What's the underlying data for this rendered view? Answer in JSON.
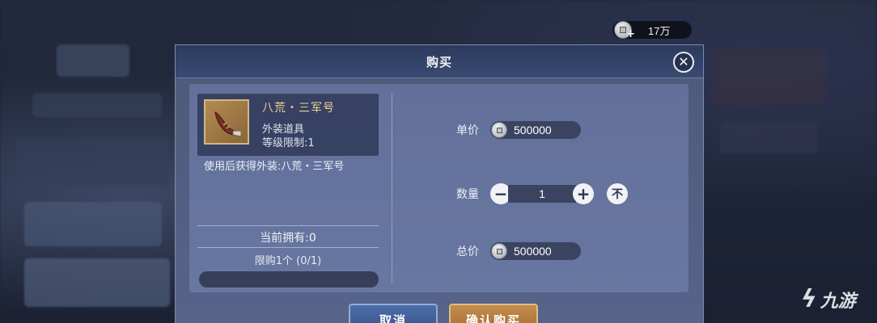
{
  "currency": {
    "amount": "17万",
    "icon": "silver-coin-add-icon"
  },
  "dialog": {
    "title": "购买",
    "close_icon": "close-icon"
  },
  "item": {
    "name": "八荒・三军号",
    "type": "外装道具",
    "level_limit": "等级限制:1",
    "description": "使用后获得外装:八荒・三军号",
    "icon": "horn-item-icon"
  },
  "ownership": {
    "owned": "当前拥有:0",
    "limit": "限购1个 (0/1)",
    "limit_progress": 0
  },
  "purchase": {
    "unit_price_label": "单价",
    "unit_price": "500000",
    "quantity_label": "数量",
    "quantity": "1",
    "minus": "−",
    "plus": "+",
    "max": "不",
    "total_label": "总价",
    "total": "500000"
  },
  "buttons": {
    "cancel": "取消",
    "confirm": "确认购买"
  },
  "watermark": {
    "logo": "ϟ",
    "text": "九游"
  },
  "colors": {
    "item_name": "#ecd38e",
    "confirm": "#b47a3c",
    "cancel": "#4262a0"
  }
}
